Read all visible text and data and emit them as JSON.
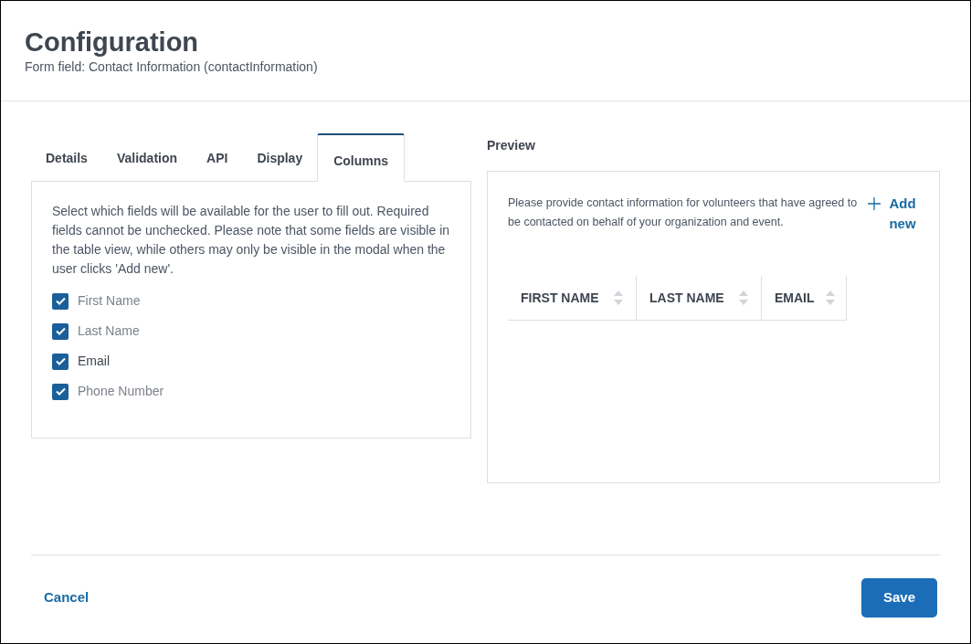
{
  "header": {
    "title": "Configuration",
    "subtitle": "Form field: Contact Information (contactInformation)"
  },
  "tabs": [
    {
      "label": "Details",
      "selected": false
    },
    {
      "label": "Validation",
      "selected": false
    },
    {
      "label": "API",
      "selected": false
    },
    {
      "label": "Display",
      "selected": false
    },
    {
      "label": "Columns",
      "selected": true
    }
  ],
  "columns_panel": {
    "description": "Select which fields will be available for the user to fill out. Required fields cannot be unchecked. Please note that some fields are visible in the table view, while others may only be visible in the modal when the user clicks 'Add new'.",
    "fields": [
      {
        "label": "First Name",
        "checked": true,
        "disabled": true
      },
      {
        "label": "Last Name",
        "checked": true,
        "disabled": true
      },
      {
        "label": "Email",
        "checked": true,
        "disabled": false
      },
      {
        "label": "Phone Number",
        "checked": true,
        "disabled": true
      }
    ]
  },
  "preview": {
    "heading": "Preview",
    "description": "Please provide contact information for volunteers that have agreed to be contacted on behalf of your organization and event.",
    "add_button": "Add new",
    "table": {
      "columns": [
        "FIRST NAME",
        "LAST NAME",
        "EMAIL"
      ]
    }
  },
  "footer": {
    "cancel": "Cancel",
    "save": "Save"
  }
}
